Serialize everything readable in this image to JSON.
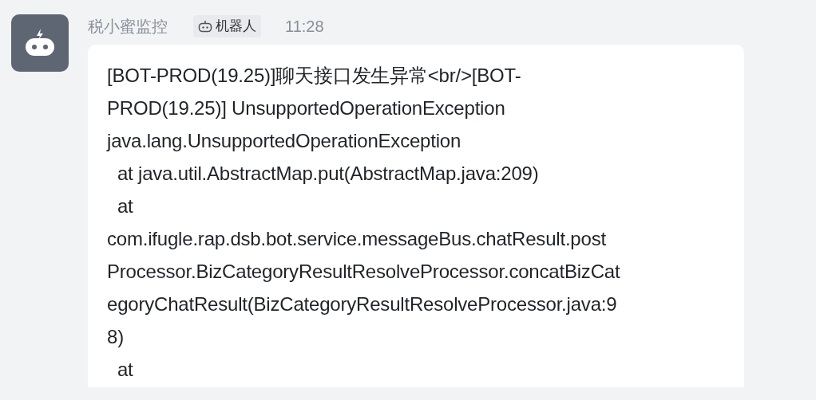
{
  "sender": {
    "name": "税小蜜监控",
    "badge": "机器人",
    "time": "11:28"
  },
  "message": {
    "lines": [
      "[BOT-PROD(19.25)]聊天接口发生异常<br/>[BOT-",
      "PROD(19.25)] UnsupportedOperationException",
      "java.lang.UnsupportedOperationException",
      "  at java.util.AbstractMap.put(AbstractMap.java:209)",
      "  at",
      "com.ifugle.rap.dsb.bot.service.messageBus.chatResult.post",
      "Processor.BizCategoryResultResolveProcessor.concatBizCat",
      "egoryChatResult(BizCategoryResultResolveProcessor.java:9",
      "8)",
      "  at"
    ]
  }
}
